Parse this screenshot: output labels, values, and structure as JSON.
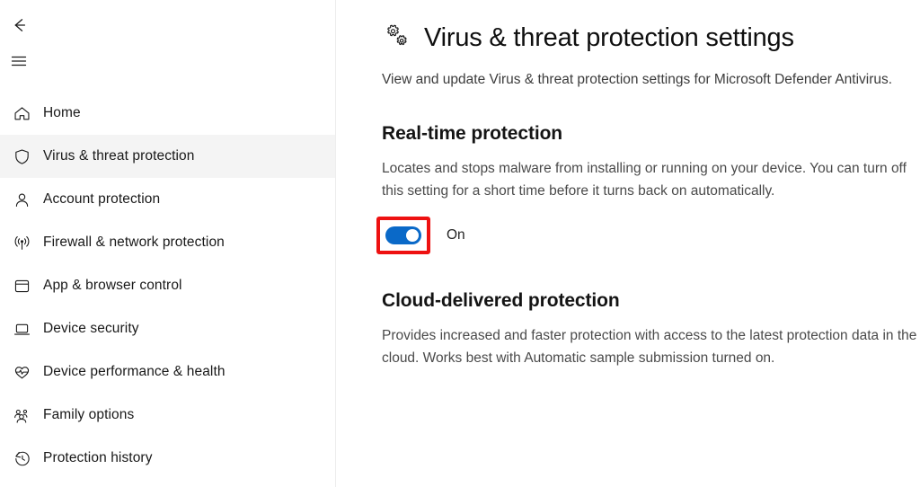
{
  "nav": {
    "back_icon": "back-arrow-icon",
    "menu_icon": "hamburger-menu-icon",
    "items": [
      {
        "label": "Home",
        "icon": "home-icon",
        "selected": false
      },
      {
        "label": "Virus & threat protection",
        "icon": "shield-icon",
        "selected": true
      },
      {
        "label": "Account protection",
        "icon": "person-icon",
        "selected": false
      },
      {
        "label": "Firewall & network protection",
        "icon": "wifi-signal-icon",
        "selected": false
      },
      {
        "label": "App & browser control",
        "icon": "browser-window-icon",
        "selected": false
      },
      {
        "label": "Device security",
        "icon": "laptop-icon",
        "selected": false
      },
      {
        "label": "Device performance & health",
        "icon": "heartbeat-icon",
        "selected": false
      },
      {
        "label": "Family options",
        "icon": "people-group-icon",
        "selected": false
      },
      {
        "label": "Protection history",
        "icon": "history-clock-icon",
        "selected": false
      }
    ]
  },
  "page": {
    "icon": "settings-gears-icon",
    "title": "Virus & threat protection settings",
    "description": "View and update Virus & threat protection settings for Microsoft Defender Antivirus."
  },
  "realtime": {
    "title": "Real-time protection",
    "description": "Locates and stops malware from installing or running on your device. You can turn off this setting for a short time before it turns back on automatically.",
    "toggle_state": "On",
    "toggle_on": true
  },
  "cloud": {
    "title": "Cloud-delivered protection",
    "description": "Provides increased and faster protection with access to the latest protection data in the cloud. Works best with Automatic sample submission turned on."
  },
  "colors": {
    "accent_blue": "#0a69c8",
    "annotation_red": "#ee1111",
    "selected_row": "#f4f4f4"
  }
}
